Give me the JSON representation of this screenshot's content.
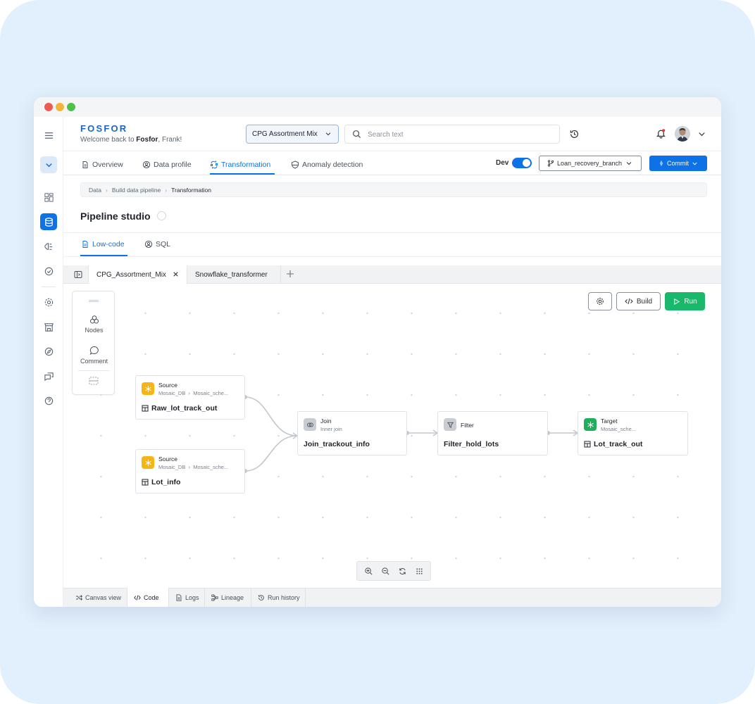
{
  "header": {
    "logo": "FOSFOR",
    "welcome_prefix": "Welcome back to ",
    "welcome_brand": "Fosfor",
    "welcome_suffix": ", Frank!",
    "project": "CPG Assortment Mix",
    "search_placeholder": "Search text"
  },
  "nav": {
    "tabs": [
      {
        "label": "Overview"
      },
      {
        "label": "Data profile"
      },
      {
        "label": "Transformation"
      },
      {
        "label": "Anomaly detection"
      }
    ],
    "active_tab": "Transformation",
    "env_label": "Dev",
    "env_enabled": true,
    "branch": "Loan_recovery_branch",
    "commit_label": "Commit"
  },
  "breadcrumb": [
    "Data",
    "Build data pipeline",
    "Transformation"
  ],
  "page": {
    "title": "Pipeline studio"
  },
  "mode_tabs": [
    {
      "label": "Low-code"
    },
    {
      "label": "SQL"
    }
  ],
  "file_tabs": [
    {
      "label": "CPG_Assortment_Mix"
    },
    {
      "label": "Snowflake_transformer"
    }
  ],
  "toolbox": {
    "nodes_label": "Nodes",
    "comment_label": "Comment"
  },
  "canvas_actions": {
    "build_label": "Build",
    "run_label": "Run"
  },
  "pipeline": {
    "nodes": [
      {
        "type": "Source",
        "sub_db": "Mosaic_DB",
        "sub_schema": "Mosaic_sche...",
        "name": "Raw_lot_track_out"
      },
      {
        "type": "Source",
        "sub_db": "Mosaic_DB",
        "sub_schema": "Mosaic_sche...",
        "name": "Lot_info"
      },
      {
        "type": "Join",
        "sub": "Inner join",
        "name": "Join_trackout_info"
      },
      {
        "type": "Filter",
        "name": "Filter_hold_lots"
      },
      {
        "type": "Target",
        "sub": "Mosaic_sche...",
        "name": "Lot_track_out"
      }
    ]
  },
  "bottom_tabs": [
    {
      "label": "Canvas view"
    },
    {
      "label": "Code"
    },
    {
      "label": "Logs"
    },
    {
      "label": "Lineage"
    },
    {
      "label": "Run history"
    }
  ],
  "colors": {
    "accent": "#0d72e6",
    "run": "#19b86a",
    "source": "#f7b515",
    "target": "#1fae5b",
    "background": "#e2effc"
  },
  "icons": [
    "menu-icon",
    "chevron-down-icon",
    "dashboard-icon",
    "database-icon",
    "brain-icon",
    "check-circle-icon",
    "gear-icon",
    "store-icon",
    "compass-icon",
    "chat-icon",
    "help-icon",
    "search-icon",
    "history-icon",
    "bell-icon",
    "branch-icon",
    "settings-icon",
    "code-icon",
    "play-icon",
    "zoom-in-icon",
    "zoom-out-icon",
    "refresh-icon",
    "grid-icon"
  ]
}
